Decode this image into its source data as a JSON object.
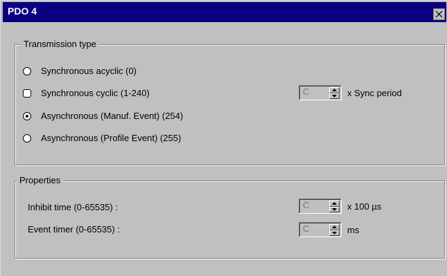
{
  "window": {
    "title": "PDO 4"
  },
  "transmission": {
    "legend": "Transmission type",
    "options": [
      {
        "label": "Synchronous acyclic (0)",
        "checked": false
      },
      {
        "label": "Synchronous cyclic (1-240)",
        "checked": false
      },
      {
        "label": "Asynchronous (Manuf. Event) (254)",
        "checked": true
      },
      {
        "label": "Asynchronous (Profile Event) (255)",
        "checked": false
      }
    ],
    "sync_period": {
      "value": "C",
      "unit": "x Sync period"
    }
  },
  "properties": {
    "legend": "Properties",
    "inhibit_time": {
      "label": "Inhibit time (0-65535) :",
      "value": "C",
      "unit": "x 100 µs"
    },
    "event_timer": {
      "label": "Event timer (0-65535) :",
      "value": "C",
      "unit": "ms"
    }
  },
  "icons": {
    "close": "close-icon",
    "spin_up": "spin-up-icon",
    "spin_down": "spin-down-icon"
  }
}
